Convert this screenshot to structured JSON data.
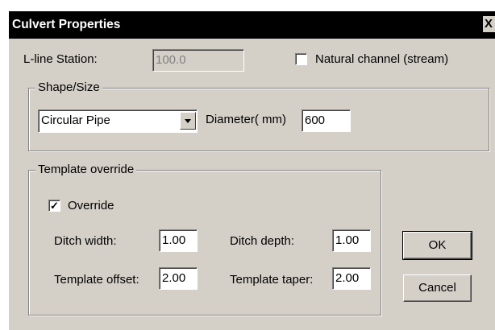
{
  "window": {
    "title": "Culvert Properties",
    "close_label": "X"
  },
  "station": {
    "label": "L-line Station:",
    "value": "100.0"
  },
  "natural_channel": {
    "label": "Natural channel (stream)",
    "checked": false
  },
  "shape_size": {
    "group_label": "Shape/Size",
    "shape_value": "Circular Pipe",
    "diameter_label": "Diameter( mm)",
    "diameter_value": "600"
  },
  "template_override": {
    "group_label": "Template override",
    "override_label": "Override",
    "override_mark": "✓",
    "ditch_width_label": "Ditch width:",
    "ditch_width_value": "1.00",
    "ditch_depth_label": "Ditch depth:",
    "ditch_depth_value": "1.00",
    "template_offset_label": "Template offset:",
    "template_offset_value": "2.00",
    "template_taper_label": "Template taper:",
    "template_taper_value": "2.00"
  },
  "buttons": {
    "ok_label": "OK",
    "cancel_label": "Cancel"
  }
}
